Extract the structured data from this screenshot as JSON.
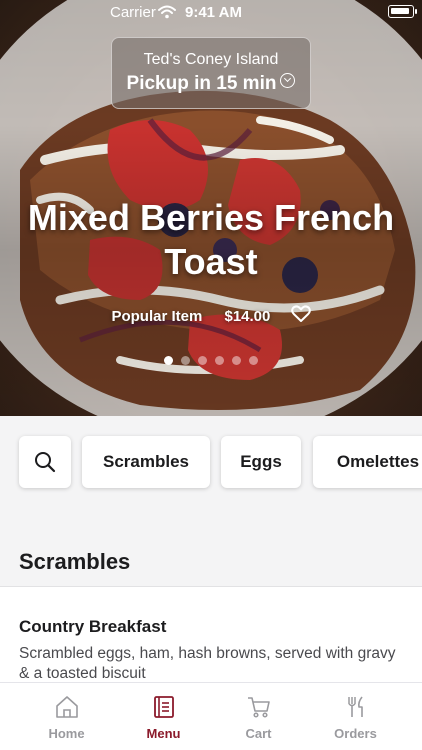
{
  "status_bar": {
    "carrier": "Carrier",
    "time": "9:41 AM"
  },
  "store": {
    "name": "Ted's Coney Island",
    "pickup": "Pickup in 15 min"
  },
  "hero": {
    "title": "Mixed Berries French Toast",
    "badge": "Popular Item",
    "price": "$14.00",
    "carousel_count": 6,
    "carousel_active": 1
  },
  "categories": {
    "search_icon": "search-icon",
    "chips": [
      "Scrambles",
      "Eggs",
      "Omelettes"
    ]
  },
  "section": {
    "title": "Scrambles"
  },
  "items": [
    {
      "name": "Country Breakfast",
      "description": "Scrambled eggs, ham, hash browns, served with gravy & a toasted biscuit"
    }
  ],
  "tab_bar": {
    "tabs": [
      {
        "label": "Home",
        "icon": "home-icon"
      },
      {
        "label": "Menu",
        "icon": "menu-icon"
      },
      {
        "label": "Cart",
        "icon": "cart-icon"
      },
      {
        "label": "Orders",
        "icon": "utensils-icon"
      }
    ],
    "active": "Menu"
  },
  "colors": {
    "accent": "#8b1a2b",
    "inactive": "#9a9a9e",
    "chip_bar_bg": "#f4f4f5"
  }
}
